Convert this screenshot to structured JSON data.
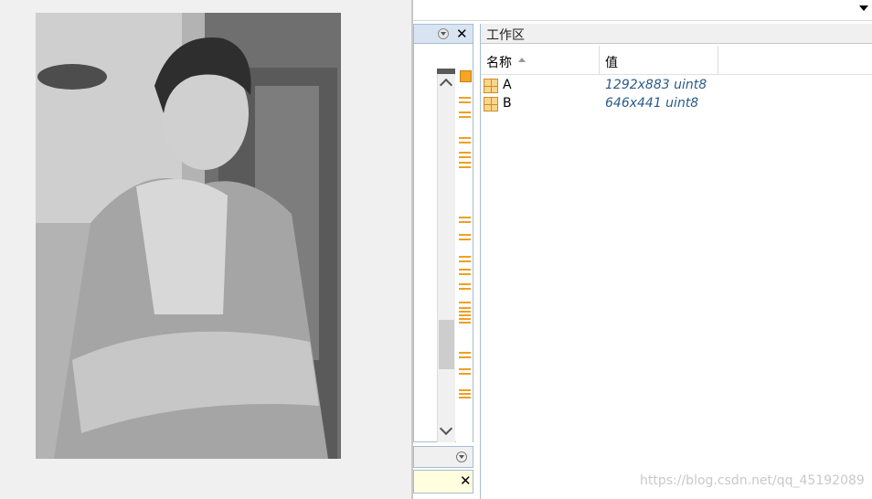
{
  "workspace": {
    "title": "工作区",
    "columns": {
      "name": "名称",
      "value": "值"
    },
    "variables": [
      {
        "name": "A",
        "value": "1292x883 uint8"
      },
      {
        "name": "B",
        "value": "646x441 uint8"
      }
    ]
  },
  "watermark": "https://blog.csdn.net/qq_45192089",
  "colors": {
    "marker": "#f0a020",
    "value_text": "#2a5b8a",
    "panel_border": "#a6bcd6"
  }
}
